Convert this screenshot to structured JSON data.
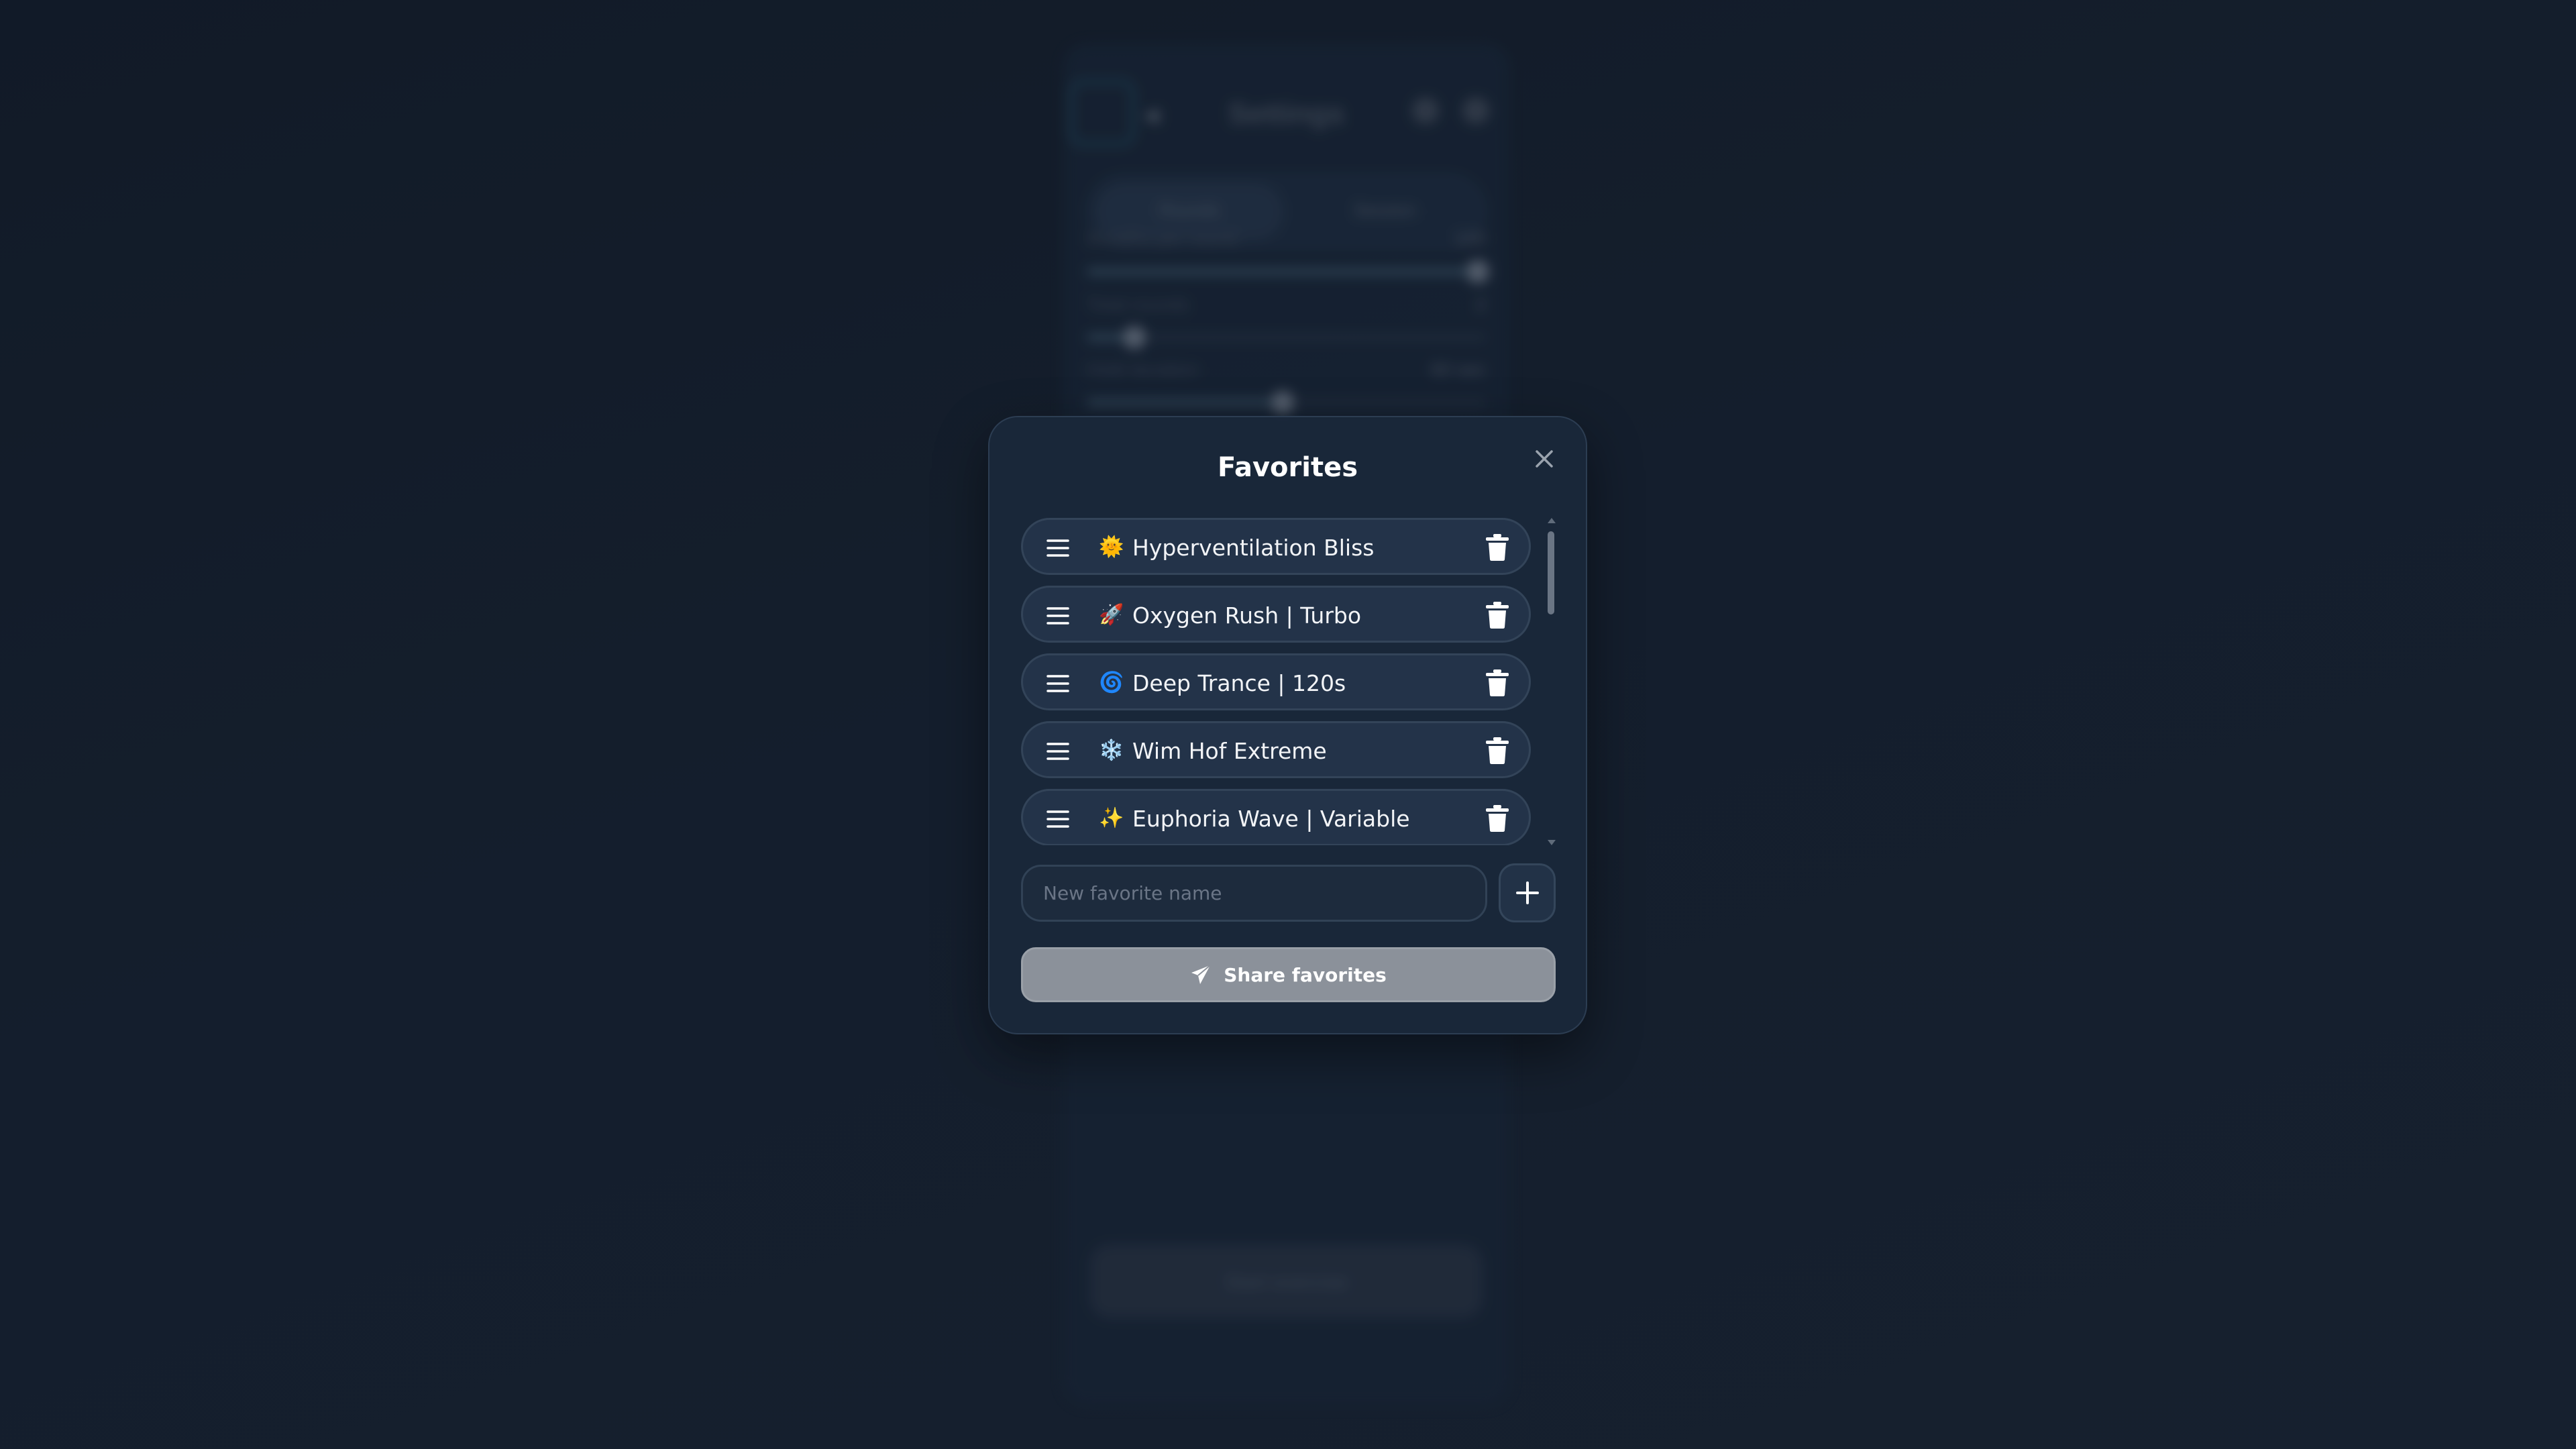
{
  "background": {
    "panel_title": "Settings",
    "tabs": [
      "Rounds",
      "Session"
    ],
    "rows": [
      {
        "label": "Breaths per round",
        "value": "100",
        "fill": 0.98
      },
      {
        "label": "Total rounds",
        "value": "2",
        "fill": 0.12
      },
      {
        "label": "Hold duration",
        "value": "60 sec",
        "fill": 0.49
      }
    ],
    "start_label": "Start exercise"
  },
  "modal": {
    "title": "Favorites",
    "favorites": [
      {
        "emoji": "🌞",
        "label": "Hyperventilation Bliss"
      },
      {
        "emoji": "🚀",
        "label": "Oxygen Rush | Turbo"
      },
      {
        "emoji": "🌀",
        "label": "Deep Trance | 120s"
      },
      {
        "emoji": "❄️",
        "label": "Wim Hof Extreme"
      },
      {
        "emoji": "✨",
        "label": "Euphoria Wave | Variable"
      }
    ],
    "new_input": {
      "placeholder": "New favorite name",
      "value": ""
    },
    "share_label": "Share favorites"
  },
  "icons": {
    "close": "close-icon",
    "drag": "drag-handle-icon",
    "delete": "trash-icon",
    "add": "plus-icon",
    "share": "paper-plane-icon"
  },
  "colors": {
    "modal_bg": "#1a283a",
    "item_bg": "#233349",
    "share_button": "#8b919a",
    "text": "#ffffff"
  }
}
